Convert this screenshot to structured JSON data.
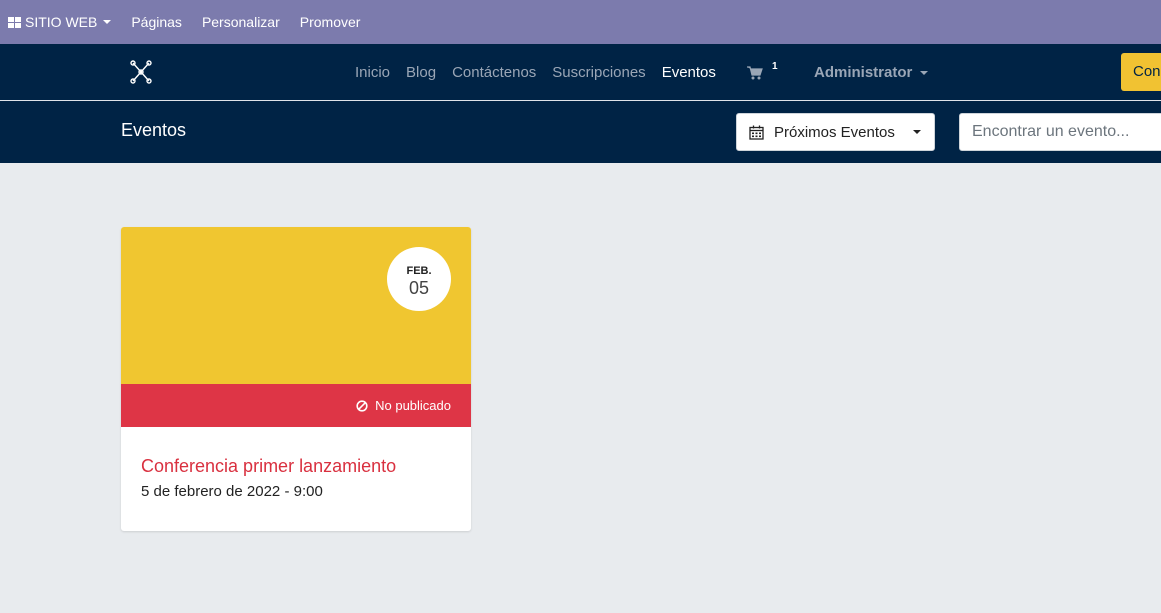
{
  "admin_bar": {
    "apps_label": "SITIO WEB",
    "menu": [
      "Páginas",
      "Personalizar",
      "Promover"
    ]
  },
  "navbar": {
    "links": [
      "Inicio",
      "Blog",
      "Contáctenos",
      "Suscripciones",
      "Eventos"
    ],
    "active_link": "Eventos",
    "cart_count": "1",
    "user_name": "Administrator",
    "cta_label": "Con"
  },
  "subheader": {
    "title": "Eventos",
    "filter_label": "Próximos Eventos",
    "search_placeholder": "Encontrar un evento..."
  },
  "events": [
    {
      "month": "FEB.",
      "day": "05",
      "status": "No publicado",
      "title": "Conferencia primer lanzamiento",
      "datetime": "5 de febrero de 2022 - 9:00"
    }
  ],
  "colors": {
    "admin_bar": "#7c7bad",
    "navbar": "#002345",
    "cover": "#f0c630",
    "unpublished": "#de3546",
    "event_title": "#d9303f",
    "cta": "#f1c232"
  }
}
